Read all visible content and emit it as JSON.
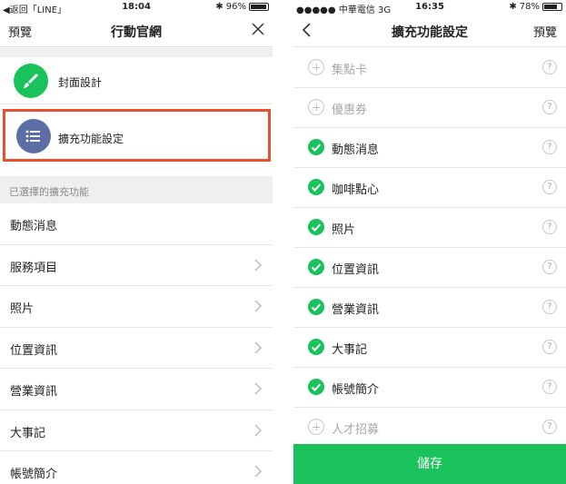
{
  "left_screen": {
    "status": {
      "back_app": "◀返回「LINE」",
      "time": "18:04",
      "battery": "96%",
      "battery_level": 0.96
    },
    "nav": {
      "left": "預覽",
      "title": "行動官網"
    },
    "cover_row": {
      "label": "封面設計",
      "icon": "brush-icon"
    },
    "extension_row": {
      "label": "擴充功能設定",
      "icon": "list-icon",
      "highlight_color": "#e8502e"
    },
    "section_header": "已選擇的擴充功能",
    "items": [
      {
        "label": "動態消息",
        "has_chevron": false
      },
      {
        "label": "服務項目",
        "has_chevron": true
      },
      {
        "label": "照片",
        "has_chevron": true
      },
      {
        "label": "位置資訊",
        "has_chevron": true
      },
      {
        "label": "營業資訊",
        "has_chevron": true
      },
      {
        "label": "大事記",
        "has_chevron": true
      },
      {
        "label": "帳號簡介",
        "has_chevron": true
      }
    ]
  },
  "right_screen": {
    "status": {
      "carrier": "中華電信",
      "network": "3G",
      "time": "16:35",
      "battery": "78%",
      "battery_level": 0.78
    },
    "nav": {
      "title": "擴充功能設定",
      "right": "預覽"
    },
    "features": [
      {
        "label": "集點卡",
        "enabled": false
      },
      {
        "label": "優惠券",
        "enabled": false
      },
      {
        "label": "動態消息",
        "enabled": true
      },
      {
        "label": "咖啡點心",
        "enabled": true
      },
      {
        "label": "照片",
        "enabled": true
      },
      {
        "label": "位置資訊",
        "enabled": true
      },
      {
        "label": "營業資訊",
        "enabled": true
      },
      {
        "label": "大事記",
        "enabled": true
      },
      {
        "label": "帳號簡介",
        "enabled": true
      },
      {
        "label": "人才招募",
        "enabled": false
      }
    ],
    "help_symbol": "?",
    "save_label": "儲存"
  },
  "colors": {
    "brand_green": "#19c25b",
    "list_icon_bg": "#5b6fa6",
    "highlight": "#e8502e",
    "section_bg": "#efeff2"
  }
}
